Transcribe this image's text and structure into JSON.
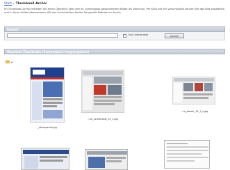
{
  "breadcrumb": {
    "home": "Start",
    "separator": "»",
    "current": "Thumbnail-Archiv"
  },
  "intro": "Im Thumbnail-Archiv erhalten Sie einen Überblick über alle im Contentpool gespeicherten Bilder als Vorschau. Per Klick auf ein Vorschaubild können Sie das Bild auswählen und in Ihren Artikel übernehmen. Mit der Suchfunktion finden Sie gezielt Dateien im Archiv.",
  "search": {
    "heading": "Suchen",
    "placeholder": "",
    "checkbox_label": "Nur Unterordner",
    "button": "Suchen"
  },
  "gallery": {
    "heading": "Übersicht Thumbnails (Contentpool: images/galerie)",
    "items": [
      {
        "caption": "_sitesspecial.jpg"
      },
      {
        "caption": "...ke_screenshot_15_1.jpg"
      },
      {
        "caption": "...ie_teaser_15_1_s.jpg"
      },
      {
        "caption": "...sitesspecials_sf.gif"
      },
      {
        "caption": "...ke_contentbox_15_1.gif"
      },
      {
        "caption": ""
      },
      {
        "caption": ""
      },
      {
        "caption": ""
      }
    ]
  },
  "colors": {
    "link": "#2a5db0",
    "panel": "#c5ccd6",
    "accent": "#1f3f8f"
  }
}
